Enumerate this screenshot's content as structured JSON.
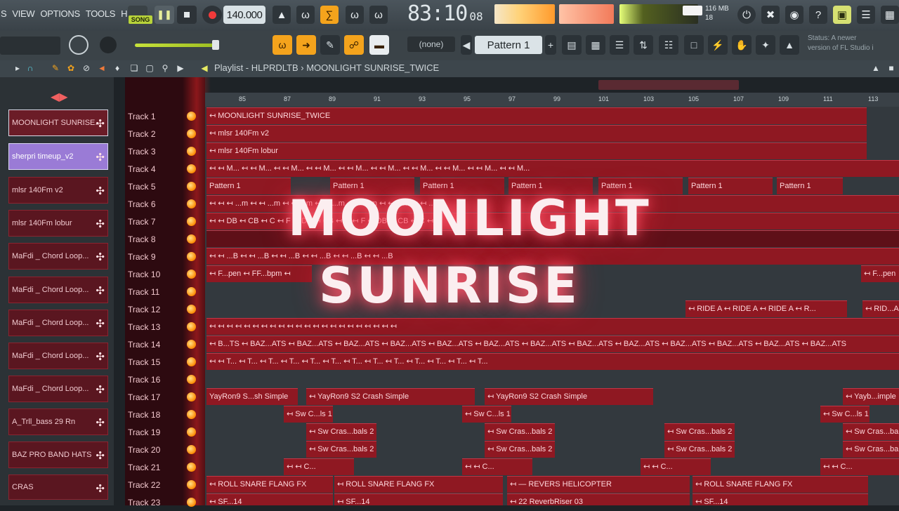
{
  "menu": [
    "S",
    "VIEW",
    "OPTIONS",
    "TOOLS",
    "HELP"
  ],
  "transport": {
    "song_label": "SONG",
    "tempo": "140.000"
  },
  "time_display": {
    "main": "83:10",
    "sub": "08"
  },
  "cpu": {
    "mem": "116 MB",
    "line2": "18"
  },
  "toolbar2": {
    "snap": "(none)",
    "pattern": "Pattern 1"
  },
  "hint": {
    "line1": "Status: A newer",
    "line2": "version of FL Studio i"
  },
  "playlist": {
    "title": "Playlist - HLPRDLTB › MOONLIGHT SUNRISE_TWICE"
  },
  "ruler_ticks": [
    "85",
    "87",
    "89",
    "91",
    "93",
    "95",
    "97",
    "99",
    "101",
    "103",
    "105",
    "107",
    "109",
    "111",
    "113"
  ],
  "browser_items": [
    "MOONLIGHT SUNRISE...",
    "sherpri timeup_v2",
    "mlsr 140Fm v2",
    "mlsr 140Fm lobur",
    "MaFdi _ Chord Loop...",
    "MaFdi _ Chord Loop...",
    "MaFdi _ Chord Loop...",
    "MaFdi _ Chord Loop...",
    "MaFdi _ Chord Loop...",
    "A_Trll_bass 29 Rn",
    "BAZ PRO BAND HATS",
    "CRAS"
  ],
  "tracks": [
    "Track 1",
    "Track 2",
    "Track 3",
    "Track 4",
    "Track 5",
    "Track 6",
    "Track 7",
    "Track 8",
    "Track 9",
    "Track 10",
    "Track 11",
    "Track 12",
    "Track 13",
    "Track 14",
    "Track 15",
    "Track 16",
    "Track 17",
    "Track 18",
    "Track 19",
    "Track 20",
    "Track 21",
    "Track 22",
    "Track 23"
  ],
  "clips": {
    "t1": "↤ MOONLIGHT SUNRISE_TWICE",
    "t2": "↤ mlsr 140Fm v2",
    "t3": "↤ mlsr 140Fm lobur",
    "t4": "↤ ↤ M... ↤ ↤ M... ↤ ↤ M... ↤ ↤ M... ↤ ↤ M... ↤ ↤ M... ↤ ↤ M... ↤ ↤ M... ↤ ↤ M... ↤ ↤ M...",
    "t5": "Pattern 1",
    "t6": "↤ ↤ ↤ ...m ↤ ↤ ...m ↤ ↤ ...m ↤ ↤ ...m ↤ ↤ ...m ↤ ↤ ...m ↤ ↤ ...m",
    "t7": "↤ ↤ DB ↤ CB ↤ C ↤ F ↤ DB ↤ CB ↤ C ↤ F ↤ DB ↤ CB ↤ C ↤ F",
    "t9": "↤ ↤ ...B ↤ ↤ ...B ↤ ↤ ...B ↤ ↤ ...B ↤ ↤ ...B ↤ ↤ ...B",
    "t10": "↤ F...pen ↤ FF...bpm ↤",
    "t10b": "↤ F...pen",
    "t12": "↤ RIDE A ↤ RIDE A ↤ RIDE A ↤ R...",
    "t12b": "↤ RID...A",
    "t13": "↤ ↤ ↤ ↤ ↤ ↤ ↤ ↤ ↤ ↤ ↤ ↤ ↤ ↤ ↤ ↤ ↤ ↤ ↤ ↤ ↤ ↤",
    "t14": "↤ B...TS ↤ BAZ...ATS ↤ BAZ...ATS ↤ BAZ...ATS ↤ BAZ...ATS ↤ BAZ...ATS ↤ BAZ...ATS ↤ BAZ...ATS ↤ BAZ...ATS ↤ BAZ...ATS ↤ BAZ...ATS ↤ BAZ...ATS ↤ BAZ...ATS ↤ BAZ...ATS",
    "t15": "↤ ↤ T... ↤ T... ↤ T... ↤ T... ↤ T... ↤ T... ↤ T... ↤ T... ↤ T... ↤ T... ↤ T... ↤ T... ↤ T...",
    "t17a": "YayRon9 S...sh Simple",
    "t17b": "↤ YayRon9 S2 Crash Simple",
    "t17c": "↤ YayRon9 S2 Crash Simple",
    "t17d": "↤ Yayb...imple",
    "t18": "↤ Sw C...ls 1",
    "t19": "↤ Sw Cras...bals 2",
    "t20": "↤ Sw Cras...bals 2",
    "t21": "↤ ↤ C...",
    "t22a": "↤ ROLL SNARE FLANG FX",
    "t22b": "↤ ROLL SNARE FLANG FX",
    "t22c": "↤ — REVERS HELICOPTER",
    "t22d": "↤ ROLL SNARE FLANG FX",
    "t23a": "↤ SF...14",
    "t23b": "↤ SF...14",
    "t23c": "↤ 22 ReverbRiser 03",
    "t23d": "↤ SF...14"
  },
  "overlay": {
    "line1": "MOONLIGHT",
    "line2": "SUNRISE"
  },
  "colors": {
    "accent": "#f4a31c",
    "clip": "#8f1822",
    "track_bg": "#2d0a10"
  }
}
